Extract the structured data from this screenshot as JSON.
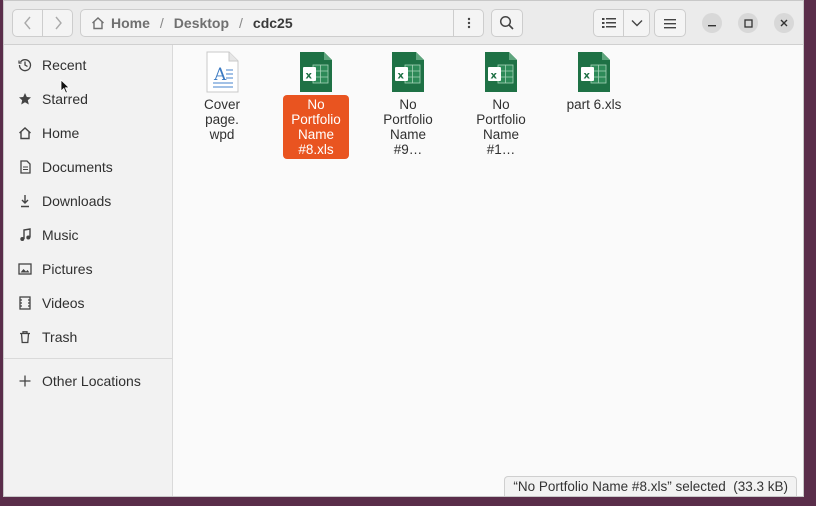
{
  "header": {
    "path": [
      "Home",
      "Desktop",
      "cdc25"
    ],
    "path_separator": "/"
  },
  "sidebar": {
    "items": [
      {
        "label": "Recent",
        "icon": "clock-icon"
      },
      {
        "label": "Starred",
        "icon": "star-icon"
      },
      {
        "label": "Home",
        "icon": "home-icon"
      },
      {
        "label": "Documents",
        "icon": "document-icon"
      },
      {
        "label": "Downloads",
        "icon": "download-icon"
      },
      {
        "label": "Music",
        "icon": "music-icon"
      },
      {
        "label": "Pictures",
        "icon": "picture-icon"
      },
      {
        "label": "Videos",
        "icon": "video-icon"
      },
      {
        "label": "Trash",
        "icon": "trash-icon"
      },
      {
        "label": "Other Locations",
        "icon": "plus-icon"
      }
    ]
  },
  "files": [
    {
      "name": "Cover page.\nwpd",
      "type": "wpd",
      "selected": false
    },
    {
      "name": "No Portfolio Name #8.xls",
      "type": "xls",
      "selected": true
    },
    {
      "name": "No Portfolio Name #9…",
      "type": "xls",
      "selected": false
    },
    {
      "name": "No Portfolio Name #1…",
      "type": "xls",
      "selected": false
    },
    {
      "name": "part 6.xls",
      "type": "xls",
      "selected": false
    }
  ],
  "status": {
    "text": "“No Portfolio Name #8.xls” selected  (33.3 kB)"
  },
  "colors": {
    "selection": "#e95420",
    "excel_green": "#1e7145"
  }
}
